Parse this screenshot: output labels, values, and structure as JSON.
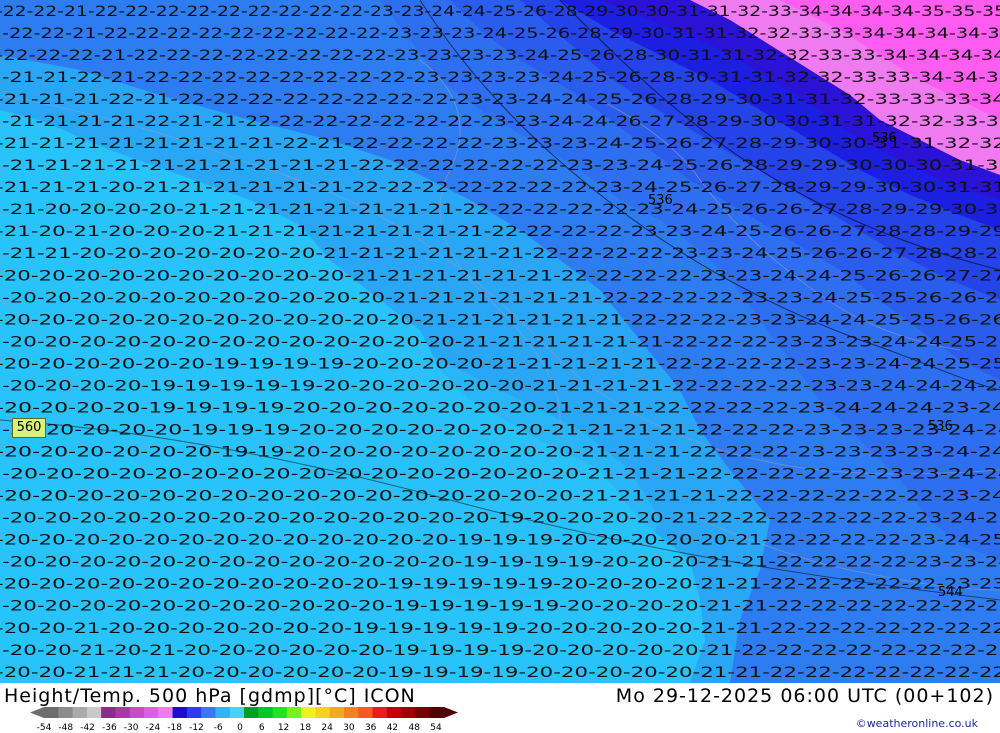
{
  "header": {
    "title": "Height/Temp. 500 hPa [gdmp][°C] ICON",
    "valid_time": "Mo 29-12-2025 06:00 UTC (00+102)"
  },
  "credit": "©weatheronline.co.uk",
  "height_labels": [
    "560",
    "536",
    "536",
    "536",
    "544"
  ],
  "legend": {
    "ticks": [
      "-54",
      "-48",
      "-42",
      "-36",
      "-30",
      "-24",
      "-18",
      "-12",
      "-6",
      "0",
      "6",
      "12",
      "18",
      "24",
      "30",
      "36",
      "42",
      "48",
      "54"
    ],
    "colors": [
      "#6e6e6e",
      "#8c8c8c",
      "#aaaaaa",
      "#c8c8c8",
      "#8a2d8a",
      "#a83aa8",
      "#c84bc8",
      "#e05ee0",
      "#f07af0",
      "#1d0dc8",
      "#2d3cf0",
      "#3a78f5",
      "#2fb4fa",
      "#46d2fa",
      "#00a028",
      "#00c828",
      "#1ee61e",
      "#78f01e",
      "#f0f01e",
      "#f5d21e",
      "#f5aa1e",
      "#f5821e",
      "#f55a1e",
      "#e61e1e",
      "#c80000",
      "#a00000",
      "#780000",
      "#500000"
    ]
  },
  "temperature_bands": [
    {
      "value": "-19",
      "color": "#27c8fb"
    },
    {
      "value": "-20",
      "color": "#27c3fa"
    },
    {
      "value": "-21",
      "color": "#29a6f5"
    },
    {
      "value": "-22",
      "color": "#2e7cf2"
    },
    {
      "value": "-23",
      "color": "#2e6ef0"
    },
    {
      "value": "-24",
      "color": "#2a5ced"
    },
    {
      "value": "-26",
      "color": "#2443e8"
    },
    {
      "value": "-28",
      "color": "#1c1ee0"
    },
    {
      "value": "-30",
      "color": "#2a12d6"
    },
    {
      "value": "-32",
      "color": "#f07af0"
    },
    {
      "value": "-34",
      "color": "#ff5cf2"
    }
  ],
  "contour_rows": [
    "-22-22-21-22-22-22-22-22-22-22-22-22-23-23-24-24-25-26-28-29-30-30-31-31-32-33-34-34-34-34-35-35-35",
    "-22-22-21-22-22-22-22-22-22-22-22-22-23-23-23-24-25-26-28-29-30-31-31-32-32-33-33-34-34-34-34-34",
    "-22-22-22-21-22-22-22-22-22-22-22-22-23-23-23-23-24-25-26-28-30-31-31-32-32-33-33-34-34-34-34",
    "-21-21-22-21-22-22-22-22-22-22-22-22-23-23-23-23-24-25-26-28-30-31-31-32-32-33-33-34-34-34",
    "-21-21-21-22-21-22-22-22-22-22-22-22-22-23-23-24-24-25-26-28-29-30-31-31-32-33-33-33-34",
    "-21-21-21-21-22-21-21-22-22-22-22-22-22-22-23-23-24-24-26-27-28-29-30-30-31-31-32-32-33-33",
    "-21-21-21-21-21-21-21-21-22-21-22-22-22-22-23-23-23-24-25-26-27-28-29-30-30-31-31-32-32",
    "-21-21-21-21-21-21-21-21-21-21-22-22-22-22-22-22-23-23-24-25-26-28-29-29-30-30-30-31-32",
    "-21-21-21-20-21-21-21-21-21-21-22-22-22-22-22-22-22-23-24-25-26-27-28-29-29-30-30-31-31",
    "-21-20-20-20-20-21-21-21-21-21-21-21-21-22-22-22-22-22-23-24-25-26-26-27-28-29-29-30-30",
    "-21-20-21-20-20-20-21-21-21-21-21-21-21-21-22-22-22-22-23-23-24-25-26-26-27-28-28-29-29",
    "-21-21-20-20-20-20-20-20-20-21-21-21-21-21-21-22-22-22-22-23-23-24-25-26-26-27-28-28-28",
    "-20-20-20-20-20-20-20-20-20-20-21-21-21-21-21-21-22-22-22-22-23-23-24-24-25-26-26-27-27",
    "-20-20-20-20-20-20-20-20-20-20-20-21-21-21-21-21-21-22-22-22-22-23-23-24-25-25-26-26-26",
    "-20-20-20-20-20-20-20-20-20-20-20-20-21-21-21-21-21-21-22-22-22-23-23-24-24-25-25-26-26",
    "-20-20-20-20-20-20-20-20-20-20-20-20-20-21-21-21-21-21-21-22-22-22-23-23-23-24-24-25-25",
    "-20-20-20-20-20-20-19-19-19-19-20-20-20-20-21-21-21-21-21-22-22-22-22-23-23-24-24-25-25",
    "-20-20-20-20-19-19-19-19-19-20-20-20-20-20-20-21-21-21-21-22-22-22-22-23-23-24-24-24-24",
    "-20-20-20-20-19-19-19-19-20-20-20-20-20-20-20-21-21-21-22-22-22-22-23-24-24-24-23-24",
    "-20-20-20-20-20-19-19-19-20-20-20-20-20-20-20-21-21-21-21-22-22-22-23-23-23-23-24-24",
    "-20-20-20-20-20-20-19-19-20-20-20-20-20-20-20-20-21-21-21-22-22-22-23-23-23-23-24-24",
    "-20-20-20-20-20-20-20-20-20-20-20-20-20-20-20-20-21-21-21-22-22-22-22-22-23-23-24-24",
    "-20-20-20-20-20-20-20-20-20-20-20-20-20-20-20-20-21-21-21-21-22-22-22-22-22-22-23-24",
    "-20-20-20-20-20-20-20-20-20-20-20-20-20-20-19-20-20-20-20-21-22-22-22-22-22-22-23-24-25",
    "-20-20-20-20-20-20-20-20-20-20-20-20-20-19-19-19-20-20-20-20-20-21-22-22-22-22-23-24-25",
    "-20-20-20-20-20-20-20-20-20-20-20-20-20-19-19-19-19-20-20-20-21-21-22-22-22-22-23-23-24",
    "-20-20-20-20-20-20-20-20-20-20-20-19-19-19-19-19-20-20-20-20-21-21-22-22-22-22-22-23-23",
    "-20-20-20-20-20-20-20-20-20-20-20-19-19-19-19-19-20-20-20-20-21-21-22-22-22-22-22-22-23",
    "-20-20-21-20-20-20-20-20-20-20-19-19-19-19-19-20-20-20-20-20-21-21-22-22-22-22-22-22-22",
    "-20-20-21-20-21-20-20-20-20-20-20-19-19-19-19-20-20-20-20-20-21-22-22-22-22-22-22-22-22",
    "-20-20-21-21-21-20-20-20-20-20-20-19-19-19-19-20-20-20-20-20-21-21-22-22-22-22-22-22-22"
  ]
}
